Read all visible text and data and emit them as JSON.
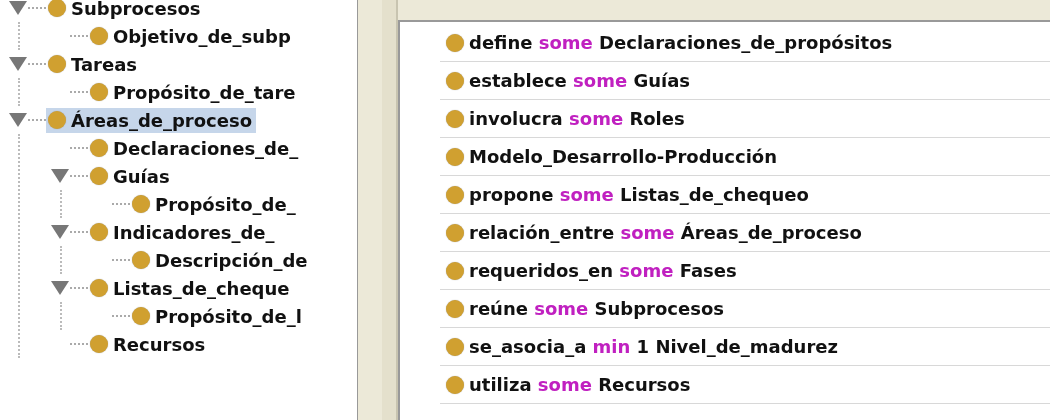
{
  "class_tree": [
    {
      "label": "Subprocesos",
      "expanded": true,
      "selected": false,
      "children": [
        {
          "label": "Objetivo_de_subp",
          "selected": false
        }
      ]
    },
    {
      "label": "Tareas",
      "expanded": true,
      "selected": false,
      "children": [
        {
          "label": "Propósito_de_tare",
          "selected": false
        }
      ]
    },
    {
      "label": "Áreas_de_proceso",
      "expanded": true,
      "selected": true,
      "children": [
        {
          "label": "Declaraciones_de_",
          "selected": false
        },
        {
          "label": "Guías",
          "expanded": true,
          "selected": false,
          "children": [
            {
              "label": "Propósito_de_",
              "selected": false
            }
          ]
        },
        {
          "label": "Indicadores_de_",
          "expanded": true,
          "selected": false,
          "children": [
            {
              "label": "Descripción_de",
              "selected": false
            }
          ]
        },
        {
          "label": "Listas_de_cheque",
          "expanded": true,
          "selected": false,
          "children": [
            {
              "label": "Propósito_de_l",
              "selected": false
            }
          ]
        },
        {
          "label": "Recursos",
          "selected": false
        }
      ]
    }
  ],
  "superclasses": [
    {
      "parts": [
        {
          "kind": "entity",
          "text": "define"
        },
        {
          "kind": "keyword",
          "text": "some"
        },
        {
          "kind": "entity",
          "text": "Declaraciones_de_propósitos"
        }
      ]
    },
    {
      "parts": [
        {
          "kind": "entity",
          "text": "establece"
        },
        {
          "kind": "keyword",
          "text": "some"
        },
        {
          "kind": "entity",
          "text": "Guías"
        }
      ]
    },
    {
      "parts": [
        {
          "kind": "entity",
          "text": "involucra"
        },
        {
          "kind": "keyword",
          "text": "some"
        },
        {
          "kind": "entity",
          "text": "Roles"
        }
      ]
    },
    {
      "parts": [
        {
          "kind": "entity",
          "text": "Modelo_Desarrollo-Producción"
        }
      ]
    },
    {
      "parts": [
        {
          "kind": "entity",
          "text": "propone"
        },
        {
          "kind": "keyword",
          "text": "some"
        },
        {
          "kind": "entity",
          "text": "Listas_de_chequeo"
        }
      ]
    },
    {
      "parts": [
        {
          "kind": "entity",
          "text": "relación_entre"
        },
        {
          "kind": "keyword",
          "text": "some"
        },
        {
          "kind": "entity",
          "text": "Áreas_de_proceso"
        }
      ]
    },
    {
      "parts": [
        {
          "kind": "entity",
          "text": "requeridos_en"
        },
        {
          "kind": "keyword",
          "text": "some"
        },
        {
          "kind": "entity",
          "text": "Fases"
        }
      ]
    },
    {
      "parts": [
        {
          "kind": "entity",
          "text": "reúne"
        },
        {
          "kind": "keyword",
          "text": "some"
        },
        {
          "kind": "entity",
          "text": "Subprocesos"
        }
      ]
    },
    {
      "parts": [
        {
          "kind": "entity",
          "text": "se_asocia_a"
        },
        {
          "kind": "keyword",
          "text": "min"
        },
        {
          "kind": "entity",
          "text": "1 Nivel_de_madurez"
        }
      ]
    },
    {
      "parts": [
        {
          "kind": "entity",
          "text": "utiliza"
        },
        {
          "kind": "keyword",
          "text": "some"
        },
        {
          "kind": "entity",
          "text": "Recursos"
        }
      ]
    }
  ]
}
